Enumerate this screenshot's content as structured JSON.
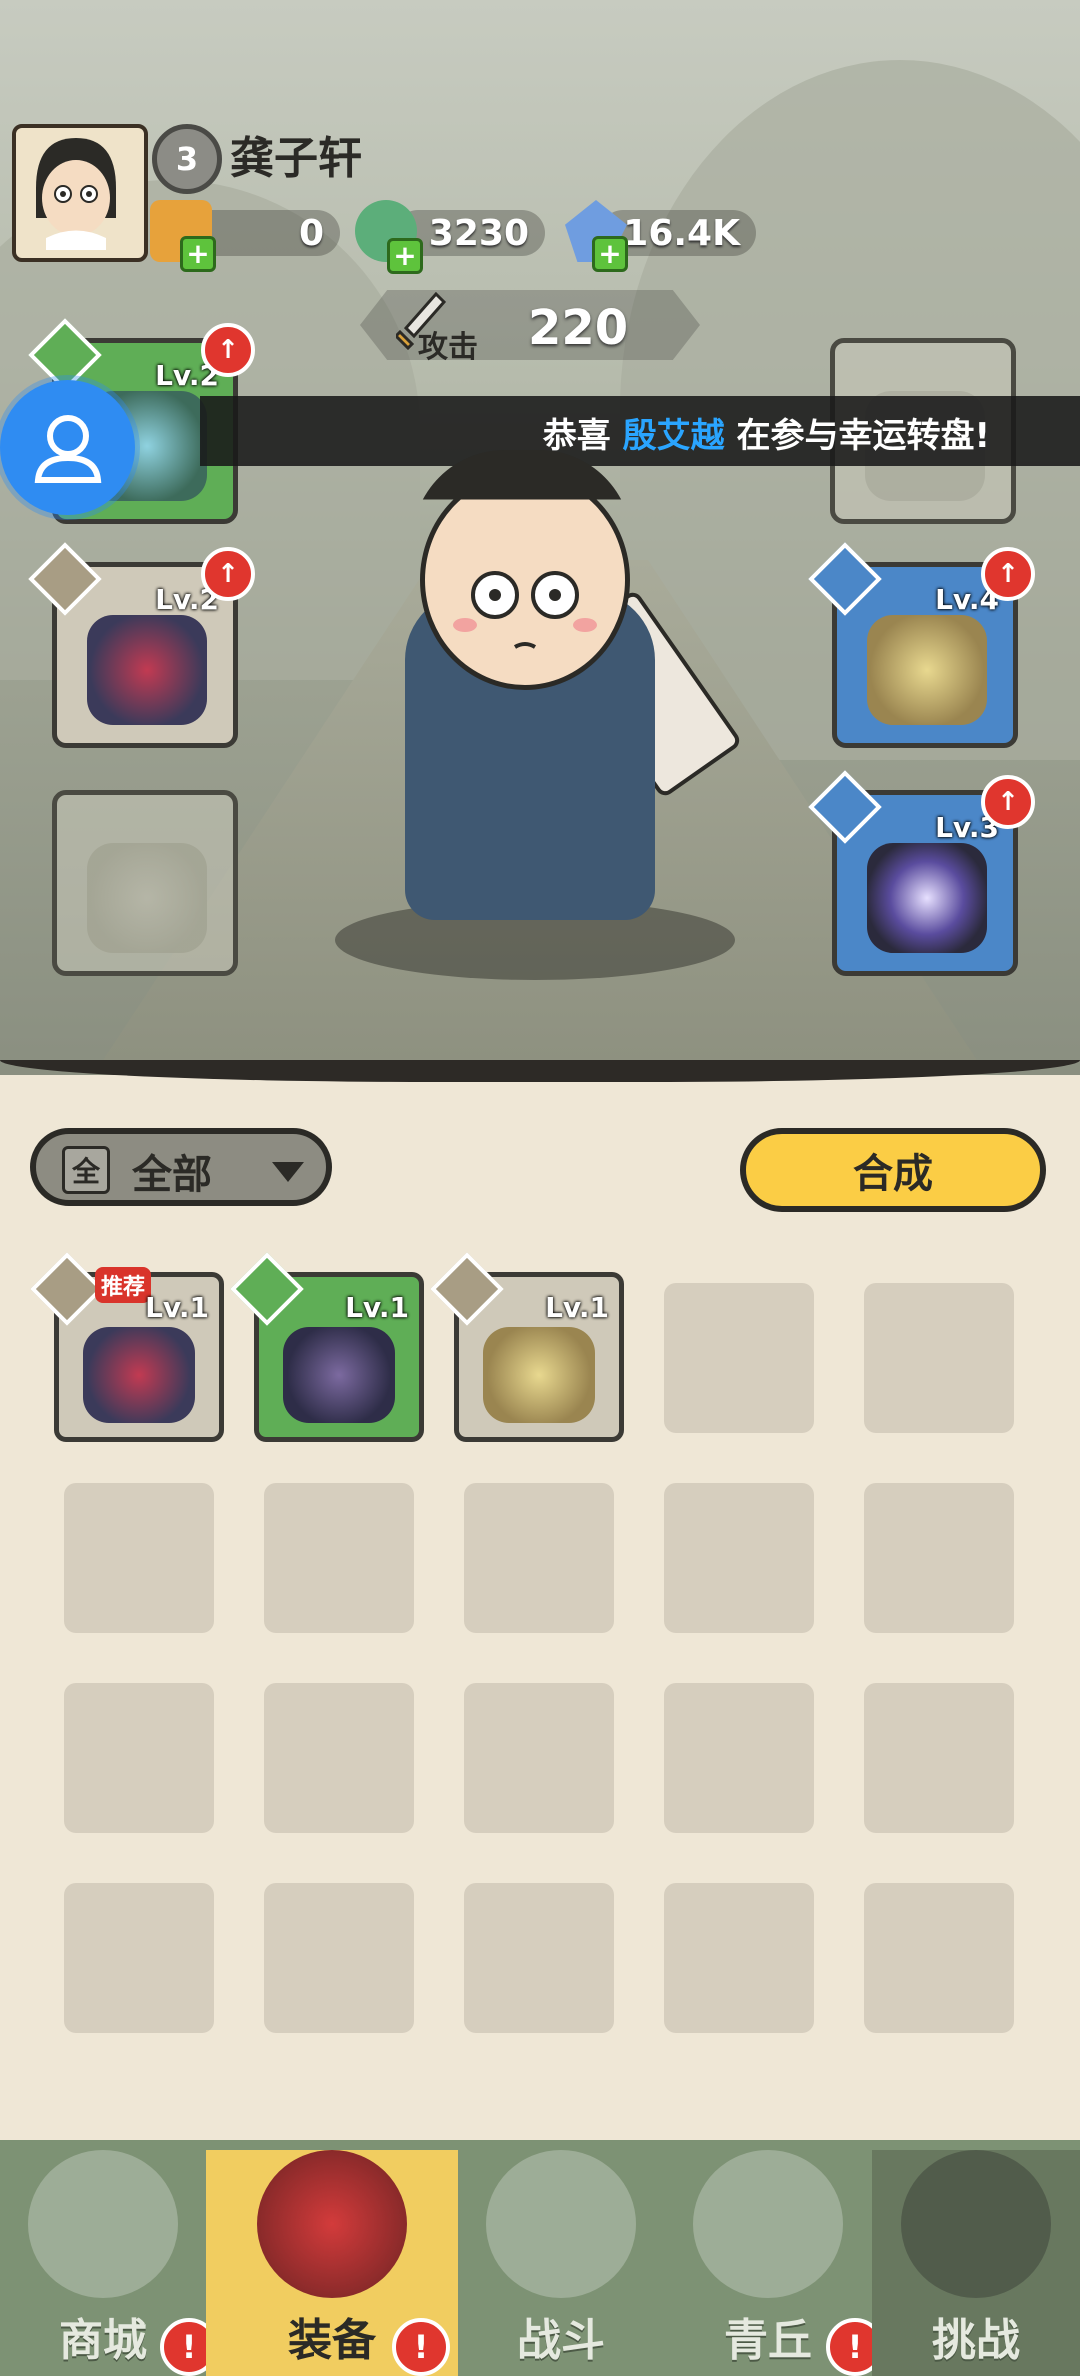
{
  "player": {
    "level": "3",
    "name": "龚子轩"
  },
  "resources": [
    {
      "icon": "ticket-scroll-icon",
      "value": "0"
    },
    {
      "icon": "jade-dragon-icon",
      "value": "3230"
    },
    {
      "icon": "blue-crystal-icon",
      "value": "16.4K"
    }
  ],
  "attack": {
    "label": "攻击",
    "value": "220"
  },
  "marquee": {
    "prefix": "恭喜 ",
    "highlight": "殷艾越",
    "suffix": " 在参与幸运转盘!"
  },
  "equipped": {
    "weapon": {
      "level": "Lv.2",
      "icon": "bow-icon"
    },
    "helmet": {
      "level": "Lv.2",
      "icon": "helmet-icon"
    },
    "accessory": {
      "icon": "empty-slot-icon"
    },
    "top_right": {
      "icon": "empty-slot-icon"
    },
    "boots": {
      "level": "Lv.4",
      "icon": "boots-icon"
    },
    "orb": {
      "level": "Lv.3",
      "icon": "orb-icon"
    }
  },
  "filter": {
    "badge": "全",
    "label": "全部"
  },
  "compose_label": "合成",
  "bag": [
    {
      "level": "Lv.1",
      "icon": "helmet-icon",
      "badge": "推荐"
    },
    {
      "level": "Lv.1",
      "icon": "dark-boots-icon"
    },
    {
      "level": "Lv.1",
      "icon": "gold-boots-icon"
    }
  ],
  "nav": [
    {
      "label": "商城",
      "icon": "shop-icon",
      "alert": "!"
    },
    {
      "label": "装备",
      "icon": "equipment-icon",
      "alert": "!"
    },
    {
      "label": "战斗",
      "icon": "crossed-swords-icon"
    },
    {
      "label": "青丘",
      "icon": "mountain-icon",
      "alert": "!"
    },
    {
      "label": "挑战",
      "icon": "challenge-icon"
    }
  ],
  "colors": {
    "accent_yellow": "#fbcd45",
    "alert_red": "#e0362e",
    "nav_green": "#7d9274",
    "highlight_blue": "#2aa5ff"
  }
}
